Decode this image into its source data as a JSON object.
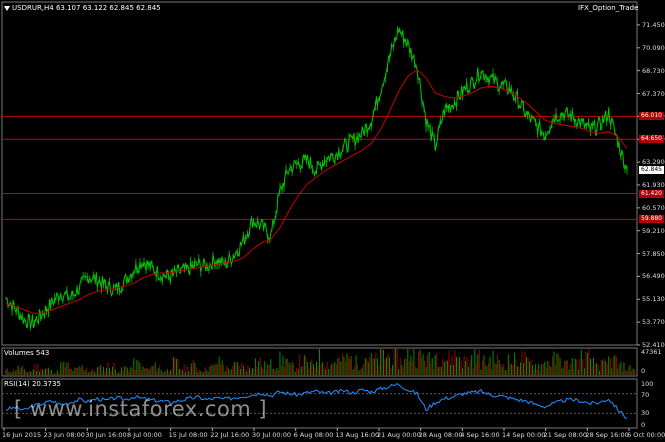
{
  "chart_header": {
    "symbol_info": "USDRUR,H4  63.107 63.122 62.845 62.845",
    "indicator_name": "IFX_Option_Trade"
  },
  "volume_panel": {
    "label": "Volumes 543",
    "max_label": "47361",
    "min_label": "0"
  },
  "rsi_panel": {
    "label": "RSI(14) 20.3735",
    "levels": [
      "100",
      "70",
      "30",
      "0"
    ]
  },
  "watermark": "[ www.instaforex.com ]",
  "colors": {
    "background": "#000000",
    "price_line": "#00c800",
    "moving_average": "#c80000",
    "levels": "#c80000",
    "rsi_line": "#1e90ff",
    "grid": "#2a2a2a"
  },
  "chart_data": {
    "type": "line",
    "title": "USDRUR,H4",
    "y_ticks": [
      "71.450",
      "70.090",
      "68.730",
      "67.370",
      "66.010",
      "64.650",
      "63.290",
      "61.930",
      "60.570",
      "59.210",
      "57.850",
      "56.490",
      "55.130",
      "53.770",
      "52.410"
    ],
    "ylim": [
      52.41,
      72.1
    ],
    "x_ticks": [
      "16 Jun 2015",
      "23 Jun 08:00",
      "30 Jun 16:00",
      "8 Jul 00:00",
      "15 Jul 08:00",
      "22 Jul 16:00",
      "30 Jul 00:00",
      "6 Aug 08:00",
      "13 Aug 16:00",
      "21 Aug 00:00",
      "28 Aug 08:00",
      "4 Sep 16:00",
      "14 Sep 00:00",
      "21 Sep 08:00",
      "28 Sep 16:00",
      "6 Oct 00:00"
    ],
    "horizontal_levels": [
      {
        "value": 66.01,
        "label": "66.010"
      },
      {
        "value": 64.65,
        "label": "64.650"
      },
      {
        "value": 61.42,
        "label": "61.420"
      },
      {
        "value": 59.88,
        "label": "59.880"
      }
    ],
    "current_price": "62.845",
    "series": [
      {
        "name": "USDRUR",
        "values": [
          55.2,
          54.6,
          53.9,
          53.7,
          54.3,
          54.9,
          55.5,
          55.2,
          55.8,
          56.5,
          56.3,
          55.9,
          55.7,
          56.2,
          56.9,
          57.4,
          57.0,
          56.6,
          56.5,
          56.8,
          56.9,
          57.2,
          57.1,
          57.5,
          57.2,
          57.8,
          58.6,
          59.8,
          59.5,
          58.9,
          61.5,
          62.9,
          63.2,
          63.4,
          62.8,
          63.5,
          63.7,
          64.2,
          64.6,
          65.0,
          65.8,
          67.6,
          69.5,
          71.2,
          70.3,
          69.0,
          65.8,
          64.2,
          66.4,
          66.8,
          67.5,
          68.0,
          68.7,
          68.3,
          67.9,
          67.7,
          67.0,
          66.1,
          65.5,
          64.9,
          66.0,
          66.2,
          66.0,
          65.6,
          65.2,
          65.5,
          66.2,
          64.5,
          62.8
        ]
      },
      {
        "name": "MA",
        "values": [
          54.9,
          54.7,
          54.5,
          54.3,
          54.3,
          54.5,
          54.7,
          54.9,
          55.1,
          55.4,
          55.6,
          55.7,
          55.8,
          55.9,
          56.1,
          56.4,
          56.6,
          56.7,
          56.7,
          56.8,
          56.9,
          57.0,
          57.1,
          57.2,
          57.3,
          57.4,
          57.6,
          58.1,
          58.5,
          58.7,
          59.4,
          60.4,
          61.3,
          62.0,
          62.4,
          62.8,
          63.1,
          63.4,
          63.7,
          64.0,
          64.4,
          65.2,
          66.3,
          67.5,
          68.4,
          68.8,
          68.3,
          67.4,
          67.2,
          67.1,
          67.2,
          67.4,
          67.7,
          67.8,
          67.7,
          67.5,
          67.2,
          66.8,
          66.3,
          65.8,
          65.6,
          65.5,
          65.4,
          65.3,
          65.1,
          65.0,
          65.1,
          64.8,
          64.1
        ]
      }
    ],
    "volumes": [
      12,
      18,
      10,
      22,
      15,
      9,
      25,
      14,
      20,
      11,
      17,
      24,
      13,
      19,
      28,
      16,
      22,
      12,
      30,
      18,
      26,
      14,
      21,
      33,
      17,
      25,
      20,
      36,
      24,
      28,
      40,
      22,
      35,
      27,
      45,
      30,
      38,
      42,
      33,
      48,
      39,
      52,
      44,
      36,
      58,
      47,
      40,
      55,
      43,
      50,
      37,
      46,
      34,
      41,
      29,
      38,
      44,
      31,
      26,
      35,
      40,
      28,
      33,
      45,
      30,
      27,
      38,
      22,
      18
    ],
    "rsi": [
      38,
      42,
      36,
      45,
      50,
      55,
      48,
      52,
      58,
      54,
      60,
      56,
      62,
      58,
      64,
      60,
      57,
      55,
      52,
      56,
      60,
      63,
      58,
      61,
      59,
      62,
      65,
      68,
      72,
      66,
      74,
      70,
      68,
      72,
      75,
      70,
      73,
      76,
      72,
      78,
      74,
      80,
      85,
      90,
      78,
      70,
      38,
      52,
      60,
      64,
      70,
      72,
      75,
      68,
      66,
      62,
      58,
      55,
      48,
      44,
      50,
      56,
      58,
      55,
      50,
      52,
      60,
      38,
      20
    ]
  }
}
